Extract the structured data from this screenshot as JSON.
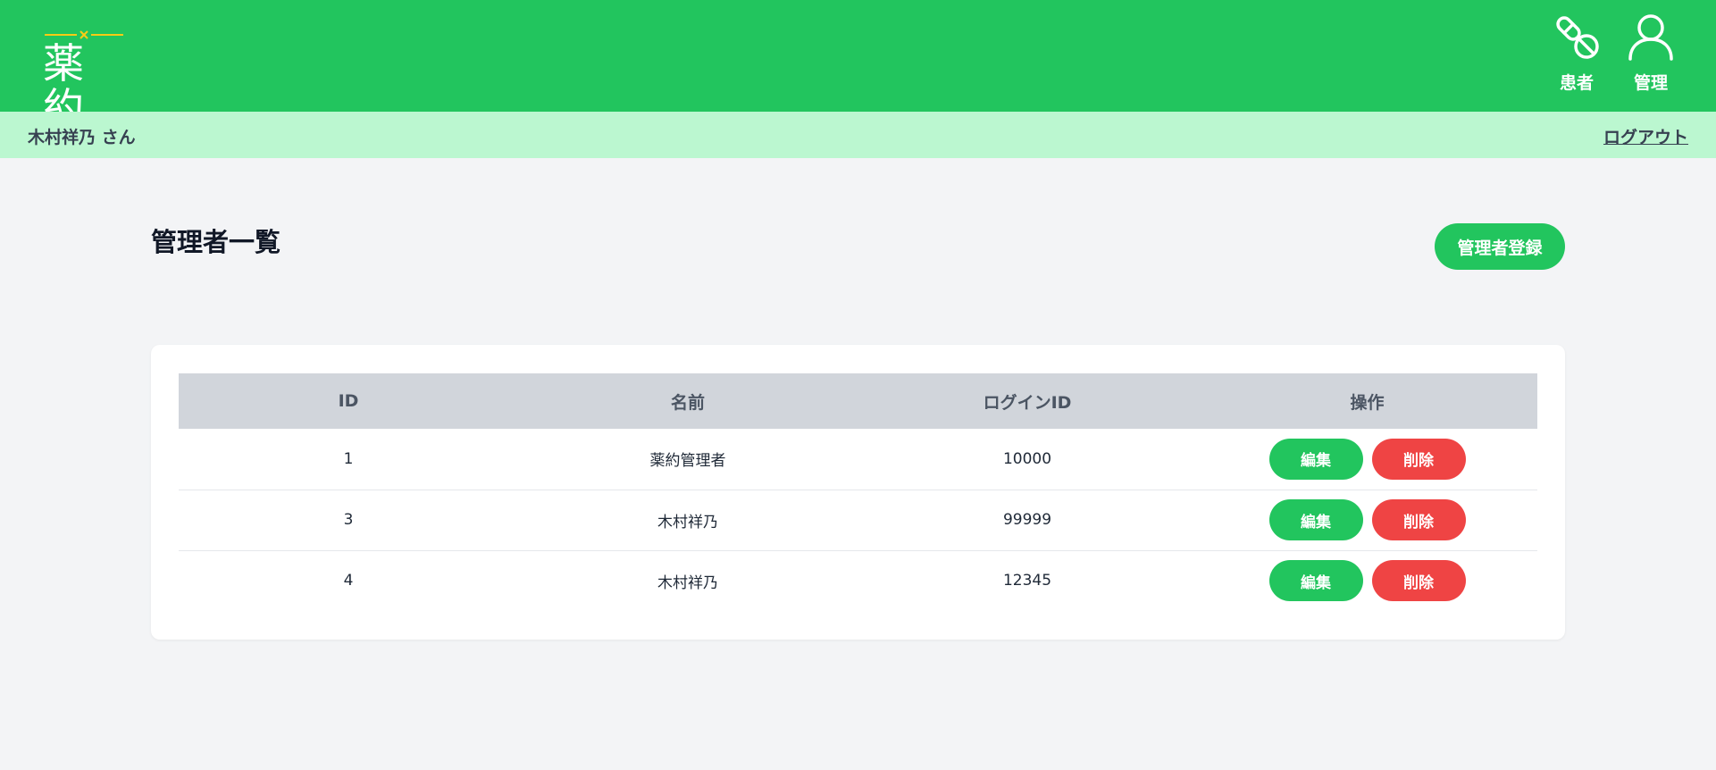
{
  "header": {
    "logo_text": "薬約",
    "nav": [
      {
        "label": "患者",
        "icon": "pill-icon"
      },
      {
        "label": "管理",
        "icon": "user-icon"
      }
    ]
  },
  "user_bar": {
    "user_name": "木村祥乃 さん",
    "logout_label": "ログアウト"
  },
  "page": {
    "title": "管理者一覧",
    "register_label": "管理者登録"
  },
  "table": {
    "columns": [
      "ID",
      "名前",
      "ログインID",
      "操作"
    ],
    "rows": [
      {
        "id": "1",
        "name": "薬約管理者",
        "login_id": "10000"
      },
      {
        "id": "3",
        "name": "木村祥乃",
        "login_id": "99999"
      },
      {
        "id": "4",
        "name": "木村祥乃",
        "login_id": "12345"
      }
    ],
    "edit_label": "編集",
    "delete_label": "削除"
  },
  "colors": {
    "primary": "#22c55e",
    "subbar": "#bbf7d0",
    "danger": "#ef4444",
    "table_header": "#d1d5db",
    "background": "#f3f4f6",
    "logo_accent": "#facc15"
  }
}
